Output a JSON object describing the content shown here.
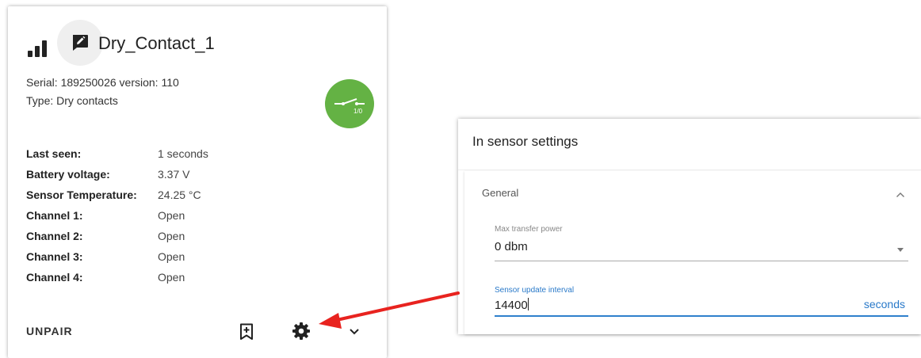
{
  "card": {
    "title": "Dry_Contact_1",
    "serial": "Serial: 189250026 version: 110",
    "type": "Type: Dry contacts",
    "badge_text": "1/0",
    "badge_color": "#64b244",
    "properties": [
      {
        "label": "Last seen:",
        "value": "1 seconds"
      },
      {
        "label": "Battery voltage:",
        "value": "3.37 V"
      },
      {
        "label": "Sensor Temperature:",
        "value": "24.25 °C"
      },
      {
        "label": "Channel 1:",
        "value": "Open"
      },
      {
        "label": "Channel 2:",
        "value": "Open"
      },
      {
        "label": "Channel 3:",
        "value": "Open"
      },
      {
        "label": "Channel 4:",
        "value": "Open"
      }
    ],
    "unpair_label": "UNPAIR",
    "icons": [
      "signal-icon",
      "edit-icon",
      "bookmark-add-icon",
      "gear-icon",
      "chevron-down-icon"
    ]
  },
  "settings": {
    "title": "In sensor settings",
    "section_title": "General",
    "max_power": {
      "label": "Max transfer power",
      "value": "0 dbm"
    },
    "update_interval": {
      "label": "Sensor update interval",
      "value": "14400",
      "suffix": "seconds"
    },
    "accent_color": "#2979c9"
  },
  "arrow_color": "#e8231f"
}
